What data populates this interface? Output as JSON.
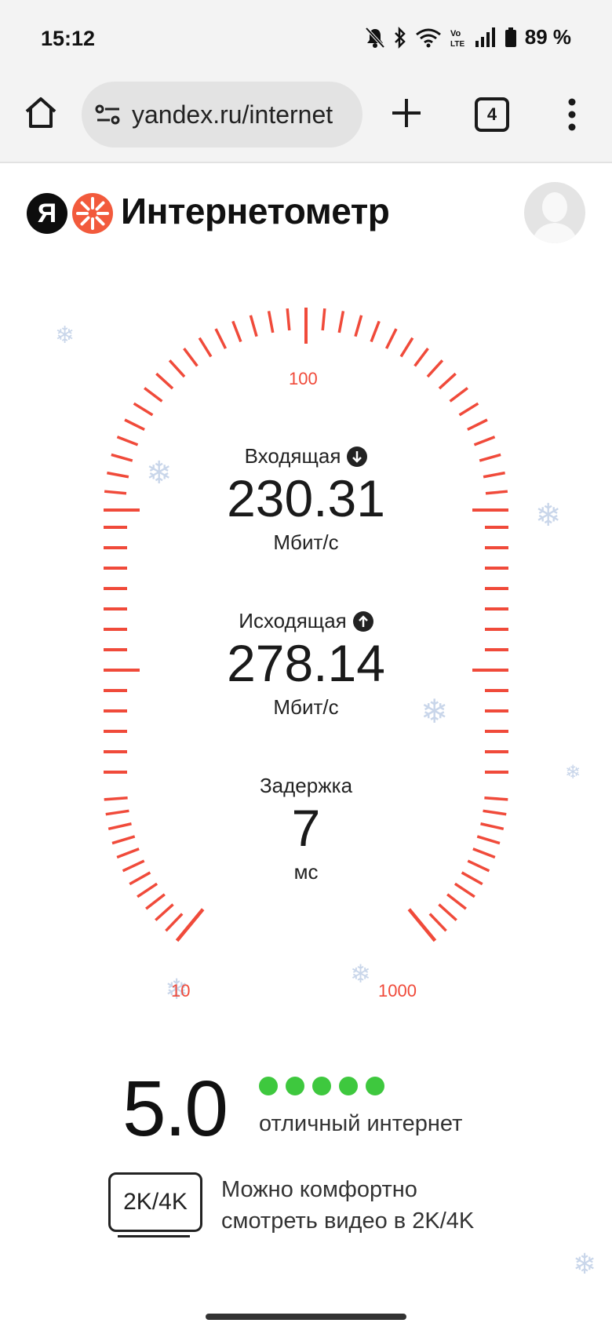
{
  "status_bar": {
    "time": "15:12",
    "battery": "89 %",
    "icons": [
      "bell-muted-icon",
      "bluetooth-icon",
      "wifi-icon",
      "volte-icon",
      "signal-icon",
      "battery-icon"
    ]
  },
  "browser": {
    "url": "yandex.ru/internet",
    "tab_count": "4",
    "icons": [
      "home-icon",
      "site-settings-icon",
      "new-tab-icon",
      "tabs-icon",
      "menu-icon"
    ]
  },
  "header": {
    "logo_letter": "Я",
    "title": "Интернетометр"
  },
  "gauge": {
    "label_top": "100",
    "label_bottom_left": "10",
    "label_bottom_right": "1000",
    "tick_color": "#f04a3a"
  },
  "metrics": {
    "download": {
      "label": "Входящая",
      "value": "230.31",
      "unit": "Мбит/с"
    },
    "upload": {
      "label": "Исходящая",
      "value": "278.14",
      "unit": "Мбит/с"
    },
    "latency": {
      "label": "Задержка",
      "value": "7",
      "unit": "мс"
    }
  },
  "rating": {
    "score": "5.0",
    "dots_filled": 5,
    "dots_total": 5,
    "dot_color": "#3ec83e",
    "quality_text": "отличный интернет",
    "badge": "2K/4K",
    "note": "Можно комфортно смотреть видео в 2K/4K"
  }
}
